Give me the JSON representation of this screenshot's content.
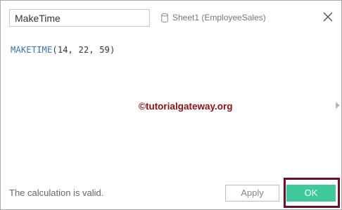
{
  "header": {
    "calc_name": "MakeTime",
    "data_source": "Sheet1 (EmployeeSales)"
  },
  "editor": {
    "function_name": "MAKETIME",
    "arguments": "(14, 22, 59)"
  },
  "watermark": "©tutorialgateway.org",
  "footer": {
    "status": "The calculation is valid.",
    "apply_label": "Apply",
    "ok_label": "OK"
  },
  "icons": {
    "data_source": "database-icon",
    "close": "close-icon",
    "expand": "expand-panel-arrow-icon"
  },
  "colors": {
    "function": "#3d72a6",
    "ok_button": "#3fc89b",
    "highlight_frame": "#6d1224",
    "watermark": "#8a1212"
  }
}
